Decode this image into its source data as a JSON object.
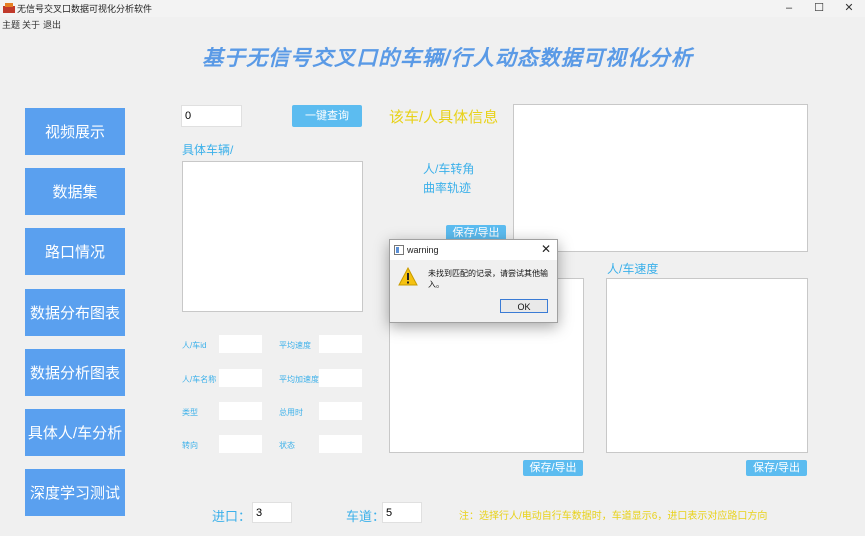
{
  "window": {
    "title": "无信号交叉口数据可视化分析软件"
  },
  "menu": {
    "items": [
      "主题",
      "关于",
      "退出"
    ]
  },
  "page": {
    "title": "基于无信号交叉口的车辆/行人动态数据可视化分析"
  },
  "sidebar": {
    "items": [
      {
        "label": "视频展示"
      },
      {
        "label": "数据集"
      },
      {
        "label": "路口情况"
      },
      {
        "label": "数据分布图表"
      },
      {
        "label": "数据分析图表"
      },
      {
        "label": "具体人/车分析"
      },
      {
        "label": "深度学习测试"
      }
    ]
  },
  "query": {
    "id_value": "0",
    "button": "一键查询",
    "vehicle_label": "具体车辆/"
  },
  "fields": {
    "person_id": "人/车id",
    "person_name": "人/车名称",
    "type": "类型",
    "turn": "转向",
    "avg_speed": "平均速度",
    "avg_accel": "平均加速度",
    "total_time": "总用时",
    "status": "状态"
  },
  "info": {
    "title": "该车/人具体信息",
    "turn_angle": "人/车转角",
    "curvature": "曲率轨迹",
    "speed": "人/车速度",
    "save1": "保存/导出",
    "save2": "保存/导出",
    "save3": "保存/导出"
  },
  "bottom": {
    "entry_label": "进口：",
    "entry_value": "3",
    "lane_label": "车道：",
    "lane_value": "5",
    "note": "注：选择行人/电动自行车数据时，车道显示6，进口表示对应路口方向"
  },
  "dialog": {
    "title": "warning",
    "message": "未找到匹配的记录，请尝试其他输入。",
    "ok": "OK"
  }
}
